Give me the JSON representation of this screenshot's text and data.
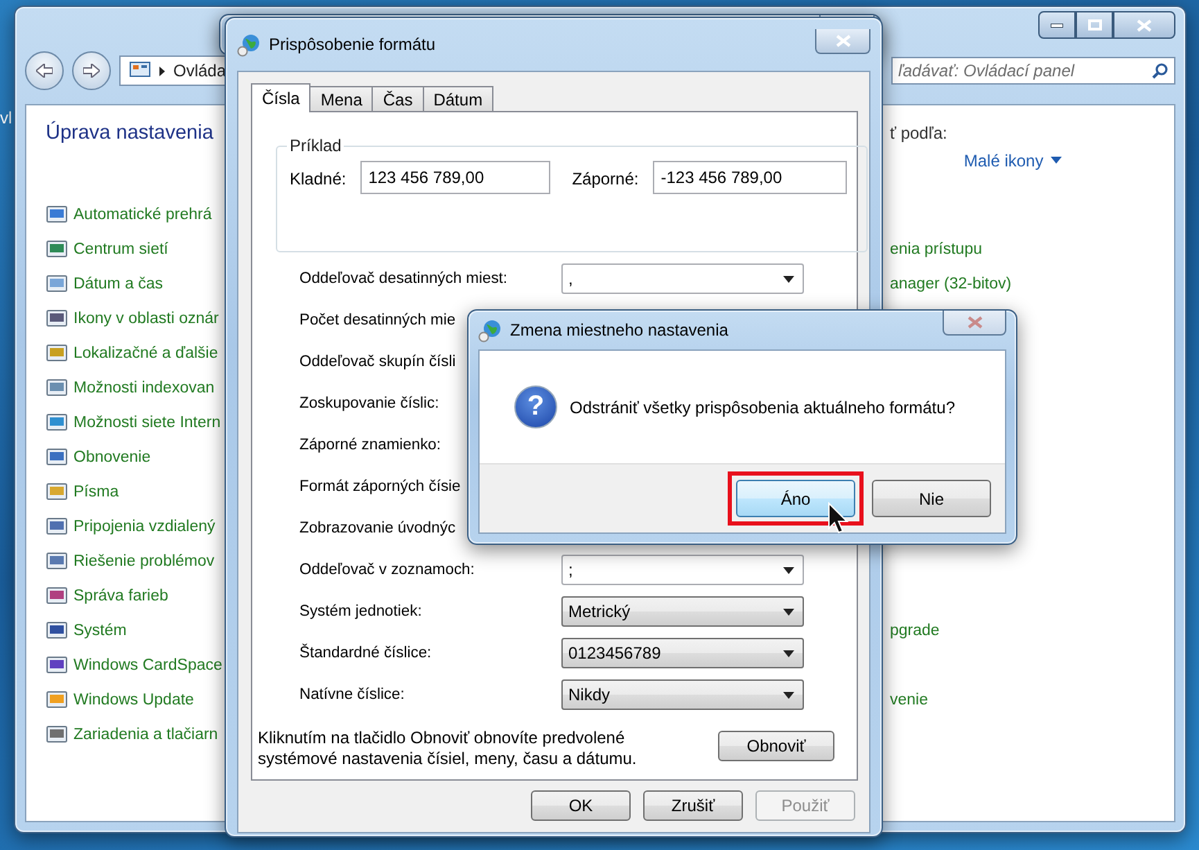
{
  "desktop": {
    "label": "vl"
  },
  "control_panel": {
    "address": "Ovláda",
    "search": {
      "placeholder": "ľadávať: Ovládací panel"
    },
    "heading": "Úprava nastavenia",
    "view_label": "ť podľa:",
    "view_value": "Malé ikony",
    "items_left": [
      {
        "label": "Automatické prehrá"
      },
      {
        "label": "Centrum sietí"
      },
      {
        "label": "Dátum a čas"
      },
      {
        "label": "Ikony v oblasti oznár"
      },
      {
        "label": "Lokalizačné a ďalšie"
      },
      {
        "label": "Možnosti indexovan"
      },
      {
        "label": "Možnosti siete Intern"
      },
      {
        "label": "Obnovenie"
      },
      {
        "label": "Písma"
      },
      {
        "label": "Pripojenia vzdialený"
      },
      {
        "label": "Riešenie problémov"
      },
      {
        "label": "Správa farieb"
      },
      {
        "label": "Systém"
      },
      {
        "label": "Windows CardSpace"
      },
      {
        "label": "Windows Update"
      },
      {
        "label": "Zariadenia a tlačiarn"
      }
    ],
    "items_right": [
      {
        "label": "enia prístupu"
      },
      {
        "label": "anager (32-bitov)"
      },
      {
        "label": "pgrade"
      },
      {
        "label": "venie"
      }
    ]
  },
  "format_window": {
    "title": "Prispôsobenie formátu",
    "tabs": [
      {
        "label": "Čísla",
        "selected": true
      },
      {
        "label": "Mena",
        "selected": false
      },
      {
        "label": "Čas",
        "selected": false
      },
      {
        "label": "Dátum",
        "selected": false
      }
    ],
    "example": {
      "legend": "Príklad",
      "positive_label": "Kladné:",
      "positive_value": "123 456 789,00",
      "negative_label": "Záporné:",
      "negative_value": "-123 456 789,00"
    },
    "settings": [
      {
        "label": "Oddeľovač desatinných miest:",
        "value": ",",
        "kind": "editable"
      },
      {
        "label": "Počet desatinných mie"
      },
      {
        "label": "Oddeľovač skupín čísli"
      },
      {
        "label": "Zoskupovanie číslic:"
      },
      {
        "label": "Záporné znamienko:"
      },
      {
        "label": "Formát záporných čísie"
      },
      {
        "label": "Zobrazovanie úvodnýc"
      },
      {
        "label": "Oddeľovač v zoznamoch:",
        "value": ";",
        "kind": "editable"
      },
      {
        "label": "Systém jednotiek:",
        "value": "Metrický",
        "kind": "list"
      },
      {
        "label": "Štandardné číslice:",
        "value": "0123456789",
        "kind": "list"
      },
      {
        "label": "Natívne číslice:",
        "value": "Nikdy",
        "kind": "list"
      }
    ],
    "reset_note": "Kliknutím na tlačidlo Obnoviť obnovíte predvolené systémové nastavenia čísiel, meny, času a dátumu.",
    "reset_button": "Obnoviť",
    "buttons": [
      {
        "label": "OK",
        "disabled": false
      },
      {
        "label": "Zrušiť",
        "disabled": false
      },
      {
        "label": "Použiť",
        "disabled": true
      }
    ]
  },
  "message_box": {
    "title": "Zmena miestneho nastavenia",
    "close_disabled": true,
    "icon_glyph": "?",
    "message": "Odstrániť všetky prispôsobenia aktuálneho formátu?",
    "buttons": [
      {
        "label": "Áno",
        "focused": true,
        "highlighted": true
      },
      {
        "label": "Nie",
        "focused": false,
        "highlighted": false
      }
    ]
  }
}
